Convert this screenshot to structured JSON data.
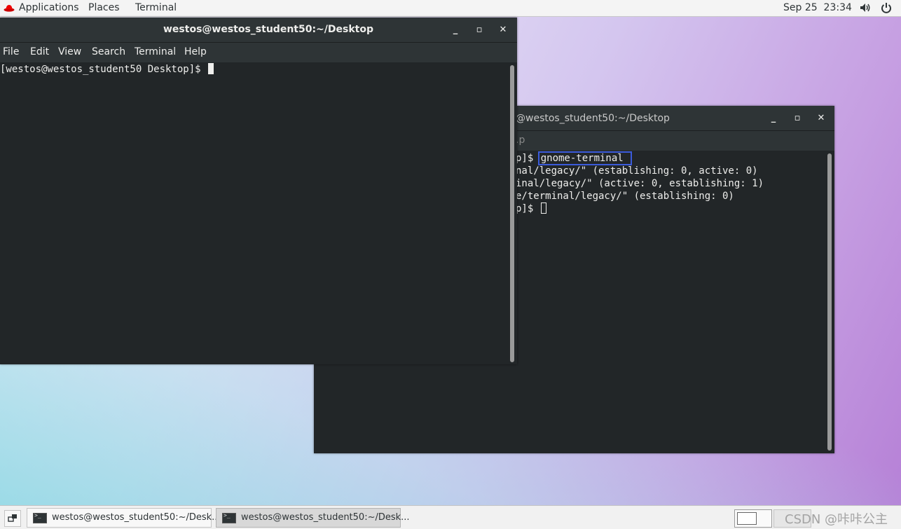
{
  "topbar": {
    "applications": "Applications",
    "places": "Places",
    "terminal": "Terminal",
    "clock": "Sep 25  23:34",
    "volume_icon": "volume-icon",
    "power_icon": "power-icon"
  },
  "front_window": {
    "title": "westos@westos_student50:~/Desktop",
    "menu": [
      "File",
      "Edit",
      "View",
      "Search",
      "Terminal",
      "Help"
    ],
    "prompt": "[westos@westos_student50 Desktop]$ "
  },
  "back_window": {
    "title": "@westos_student50:~/Desktop",
    "menu_partial": ".p",
    "lines": [
      "p]$ ",
      "nal/legacy/\" (establishing: 0, active: 0)",
      "inal/legacy/\" (active: 0, establishing: 1)",
      "e/terminal/legacy/\" (establishing: 0)",
      "p]$ "
    ],
    "highlighted_command": "gnome-terminal",
    "highlight_color": "#3b5bdb"
  },
  "taskbar": {
    "tasks": [
      {
        "label": "westos@westos_student50:~/Desk..."
      },
      {
        "label": "westos@westos_student50:~/Desk..."
      }
    ],
    "watermark": "CSDN @咔咔公主"
  }
}
